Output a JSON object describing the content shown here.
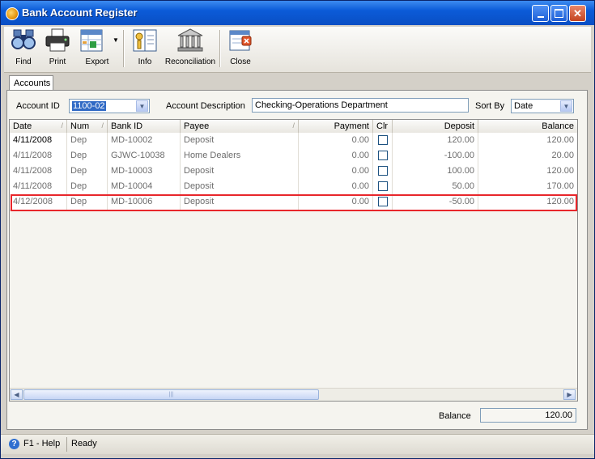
{
  "window": {
    "title": "Bank Account Register"
  },
  "toolbar": {
    "find": "Find",
    "print": "Print",
    "export": "Export",
    "info": "Info",
    "reconciliation": "Reconciliation",
    "close": "Close"
  },
  "tabs": [
    {
      "label": "Accounts"
    }
  ],
  "filters": {
    "account_id_label": "Account ID",
    "account_id_value": "1100-02",
    "account_description_label": "Account Description",
    "account_description_value": "Checking-Operations Department",
    "sort_by_label": "Sort By",
    "sort_by_value": "Date"
  },
  "grid": {
    "columns": [
      "Date",
      "Num",
      "Bank ID",
      "Payee",
      "Payment",
      "Clr",
      "Deposit",
      "Balance"
    ],
    "rows": [
      {
        "date": "4/11/2008",
        "num": "Dep",
        "bank_id": "MD-10002",
        "payee": "Deposit",
        "payment": "0.00",
        "clr": false,
        "deposit": "120.00",
        "balance": "120.00"
      },
      {
        "date": "4/11/2008",
        "num": "Dep",
        "bank_id": "GJWC-10038",
        "payee": "Home Dealers",
        "payment": "0.00",
        "clr": false,
        "deposit": "-100.00",
        "balance": "20.00"
      },
      {
        "date": "4/11/2008",
        "num": "Dep",
        "bank_id": "MD-10003",
        "payee": "Deposit",
        "payment": "0.00",
        "clr": false,
        "deposit": "100.00",
        "balance": "120.00"
      },
      {
        "date": "4/11/2008",
        "num": "Dep",
        "bank_id": "MD-10004",
        "payee": "Deposit",
        "payment": "0.00",
        "clr": false,
        "deposit": "50.00",
        "balance": "170.00"
      },
      {
        "date": "4/12/2008",
        "num": "Dep",
        "bank_id": "MD-10006",
        "payee": "Deposit",
        "payment": "0.00",
        "clr": false,
        "deposit": "-50.00",
        "balance": "120.00"
      }
    ]
  },
  "footer": {
    "balance_label": "Balance",
    "balance_value": "120.00"
  },
  "status": {
    "help": "F1 - Help",
    "state": "Ready"
  },
  "colors": {
    "highlight": "#e8262b",
    "titlebar": "#0b5bd8",
    "selection": "#316ac5"
  },
  "icons": [
    "app-icon",
    "binoculars-icon",
    "printer-icon",
    "export-icon",
    "info-icon",
    "bank-icon",
    "close-doc-icon",
    "help-icon"
  ]
}
